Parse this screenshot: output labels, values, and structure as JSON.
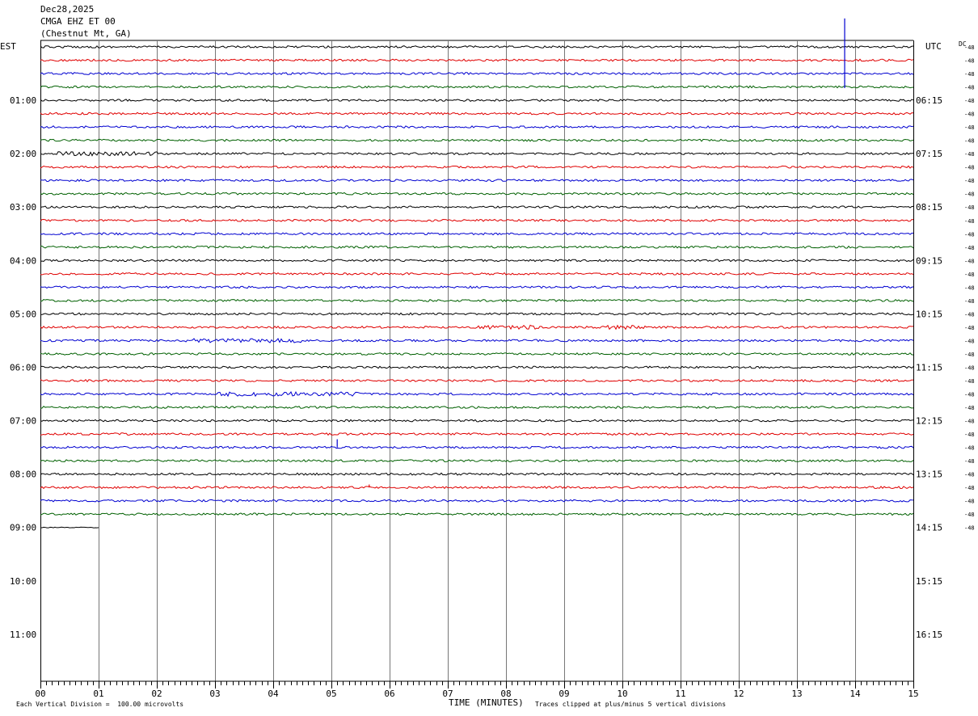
{
  "header": {
    "date": "Dec28,2025",
    "station": "CMGA EHZ ET 00",
    "location": "(Chestnut Mt, GA)"
  },
  "left_axis_label": "EST",
  "right_axis_label": "UTC",
  "dc_label": "DC",
  "footer": {
    "scale_text": "Each Vertical Division =  100.00 microvolts",
    "xlabel": "TIME (MINUTES)",
    "clip_text": "Traces clipped at plus/minus 5 vertical divisions"
  },
  "chart_data": {
    "type": "line",
    "title": "CMGA EHZ ET 00 (Chestnut Mt, GA) Dec28,2025",
    "xlabel": "TIME (MINUTES)",
    "x_range": [
      0,
      15
    ],
    "x_ticks": [
      "00",
      "01",
      "02",
      "03",
      "04",
      "05",
      "06",
      "07",
      "08",
      "09",
      "10",
      "11",
      "12",
      "13",
      "14",
      "15"
    ],
    "rows_per_hour": 4,
    "row_minutes": 15,
    "est_labels": [
      "01:00",
      "02:00",
      "03:00",
      "04:00",
      "05:00",
      "06:00",
      "07:00",
      "08:00",
      "09:00",
      "10:00",
      "11:00"
    ],
    "utc_labels": [
      "06:15",
      "07:15",
      "08:15",
      "09:15",
      "10:15",
      "11:15",
      "12:15",
      "13:15",
      "14:15",
      "15:15",
      "16:15"
    ],
    "dc_offsets": [
      "-48",
      "-48",
      "-48",
      "-48",
      "-48",
      "-48",
      "-48",
      "-48",
      "-48",
      "-48",
      "-48",
      "-48",
      "-48",
      "-48",
      "-48",
      "-48",
      "-48",
      "-48",
      "-48",
      "-48",
      "-48",
      "-48",
      "-48",
      "-48",
      "-48",
      "-48",
      "-48",
      "-48",
      "-48",
      "-48",
      "-48",
      "-48",
      "-48",
      "-48",
      "-48",
      "-48",
      "-48"
    ],
    "trace_colors": [
      "#000000",
      "#e00000",
      "#0000d0",
      "#006000"
    ],
    "trace_count": 37,
    "last_trace_minutes": 1.0,
    "events": [
      {
        "trace": 2,
        "minute": 13.82,
        "amplitude": 5,
        "direction": "both",
        "color": "#0000d0"
      },
      {
        "trace": 30,
        "minute": 5.1,
        "amplitude": 1.4,
        "direction": "up",
        "color": "#0000d0"
      },
      {
        "trace": 33,
        "minute": 5.65,
        "amplitude": 0.5,
        "direction": "up",
        "color": "#e00000"
      }
    ],
    "noisy_segments": [
      {
        "trace": 8,
        "from": 0.3,
        "to": 2.0
      },
      {
        "trace": 21,
        "from": 7.5,
        "to": 8.6
      },
      {
        "trace": 21,
        "from": 9.7,
        "to": 10.4
      },
      {
        "trace": 26,
        "from": 3.0,
        "to": 5.5
      },
      {
        "trace": 22,
        "from": 2.5,
        "to": 4.5
      }
    ],
    "grid": true
  }
}
